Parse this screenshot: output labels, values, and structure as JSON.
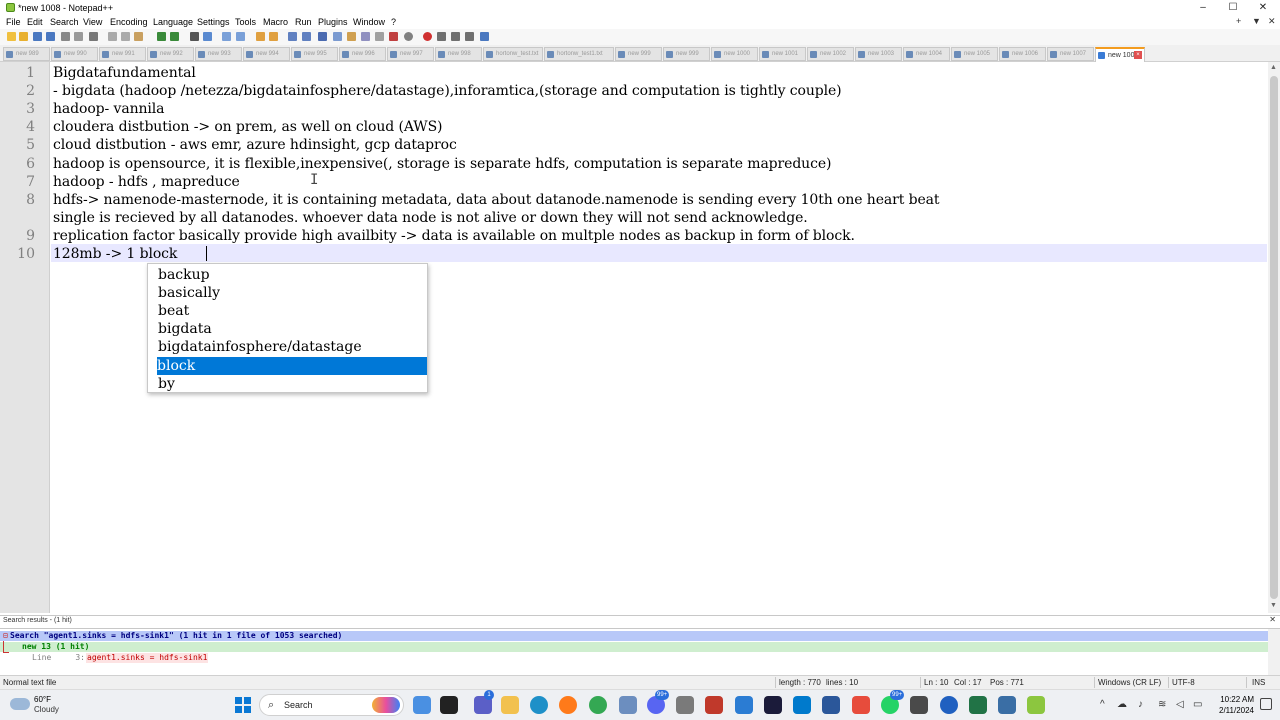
{
  "window": {
    "title": "*new 1008 - Notepad++",
    "controls": {
      "minimize": "–",
      "maximize": "☐",
      "close": "✕"
    }
  },
  "menu": {
    "items": [
      "File",
      "Edit",
      "Search",
      "View",
      "Encoding",
      "Language",
      "Settings",
      "Tools",
      "Macro",
      "Run",
      "Plugins",
      "Window",
      "?"
    ],
    "right": [
      "+",
      "▼",
      "✕"
    ]
  },
  "tabs": [
    "new 989",
    "new 990",
    "new 991",
    "new 992",
    "new 993",
    "new 994",
    "new 995",
    "new 996",
    "new 997",
    "new 998",
    "hortonw_test.txt",
    "hortonw_test1.txt",
    "new 999",
    "new 999",
    "new 1000",
    "new 1001",
    "new 1002",
    "new 1003",
    "new 1004",
    "new 1005",
    "new 1006",
    "new 1007",
    "new 1008"
  ],
  "active_tab": "new 1008",
  "editor": {
    "lines": [
      {
        "num": "1",
        "text": "Bigdatafundamental"
      },
      {
        "num": "2",
        "text": "- bigdata (hadoop /netezza/bigdatainfosphere/datastage),inforamtica,(storage and computation is tightly couple)"
      },
      {
        "num": "3",
        "text": "hadoop- vannila"
      },
      {
        "num": "4",
        "text": "cloudera distbution -> on prem, as well on cloud (AWS)"
      },
      {
        "num": "5",
        "text": "cloud distbution - aws emr, azure hdinsight, gcp dataproc"
      },
      {
        "num": "6",
        "text": "hadoop is opensource, it is flexible,inexpensive(, storage is separate hdfs, computation is separate mapreduce)"
      },
      {
        "num": "7",
        "text": "hadoop - hdfs , mapreduce"
      },
      {
        "num": "8",
        "text": "hdfs-> namenode-masternode, it is containing metadata, data about datanode.namenode is sending every 10th one heart beat"
      },
      {
        "num": "",
        "text": "single is recieved by all datanodes. whoever data node is not alive or down they will not send acknowledge."
      },
      {
        "num": "9",
        "text": "replication factor basically provide high availbity -> data is available on multple nodes as backup in form of block."
      },
      {
        "num": "10",
        "text": "128mb -> 1 block"
      }
    ],
    "cursor_glyph": "I"
  },
  "autocomplete": {
    "items": [
      "backup",
      "basically",
      "beat",
      "bigdata",
      "bigdatainfosphere/datastage",
      "block",
      "by"
    ],
    "selected": "block"
  },
  "search_results": {
    "title": "Search results - (1 hit)",
    "close": "✕",
    "header": "Search \"agent1.sinks = hdfs-sink1\" (1 hit in 1 file of 1053 searched)",
    "file": "new 13 (1 hit)",
    "line_prefix": "Line     3: ",
    "match": "agent1.sinks = hdfs-sink1",
    "fold": "⊟"
  },
  "status": {
    "type": "Normal text file",
    "length": "length : 770",
    "lines": "lines : 10",
    "ln": "Ln : 10",
    "col": "Col : 17",
    "pos": "Pos : 771",
    "eol": "Windows (CR LF)",
    "encoding": "UTF-8",
    "mode": "INS"
  },
  "taskbar": {
    "weather_temp": "60°F",
    "weather_cond": "Cloudy",
    "search_placeholder": "Search",
    "badges": {
      "teams": "1",
      "discord": "99+",
      "whatsapp": "99+"
    },
    "time": "10:22 AM",
    "date": "2/11/2024"
  },
  "colors": {
    "current_line": "#e8e8ff",
    "selection": "#0078d7",
    "active_tab_accent": "#f39c1f",
    "search_header_bg": "#b8c8f8",
    "search_file_bg": "#cfeecf",
    "match_red": "#c00000"
  }
}
